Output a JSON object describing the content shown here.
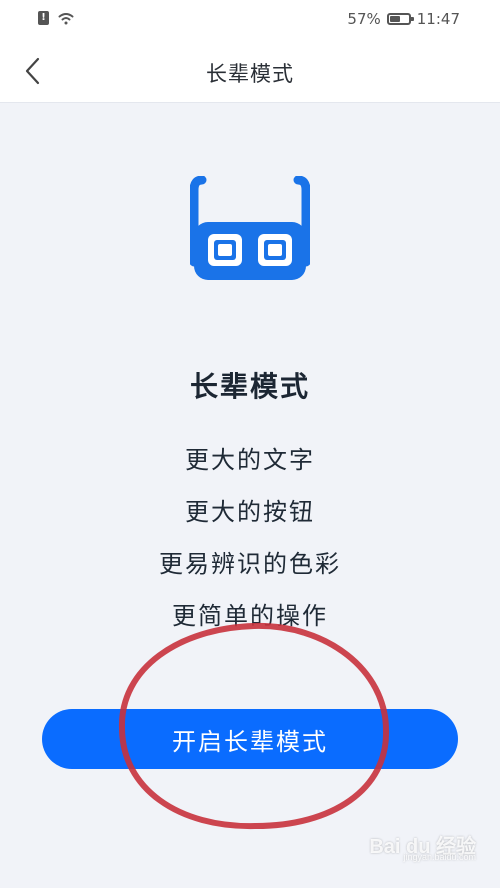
{
  "status_bar": {
    "sim_alert": "!",
    "battery_percent": "57%",
    "battery_level": 0.57,
    "time": "11:47"
  },
  "header": {
    "title": "长辈模式",
    "back_icon": "chevron-left-icon"
  },
  "main": {
    "icon": "glasses-icon",
    "accent_color": "#1a73e8",
    "title": "长辈模式",
    "features": [
      "更大的文字",
      "更大的按钮",
      "更易辨识的色彩",
      "更简单的操作"
    ],
    "enable_button_label": "开启长辈模式",
    "button_color": "#0a6cff"
  },
  "annotation": {
    "circle_color": "#c8323c"
  },
  "watermark": {
    "text": "Bai du 经验",
    "sub": "jingyan.baidu.com"
  }
}
